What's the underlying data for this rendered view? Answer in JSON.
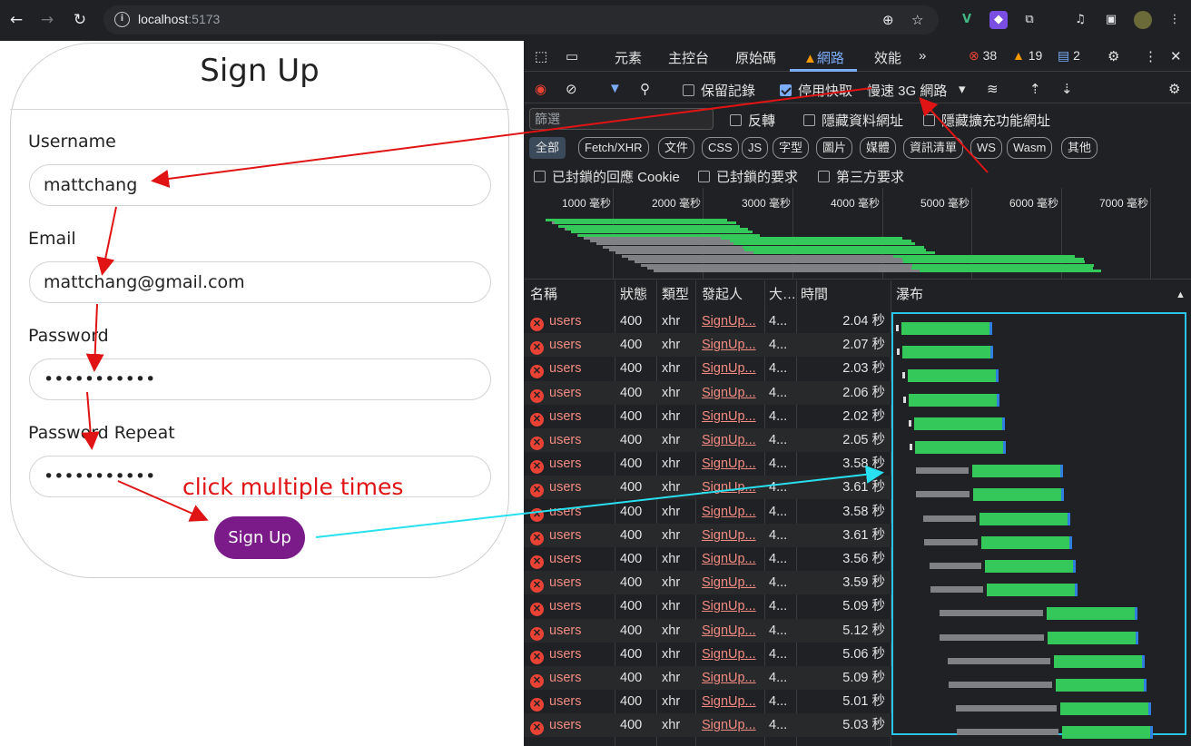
{
  "browser": {
    "url_host": "localhost",
    "url_port": ":5173",
    "nav": [
      "←",
      "→",
      "↻"
    ]
  },
  "form": {
    "title": "Sign Up",
    "fields": [
      {
        "label": "Username",
        "value": "mattchang"
      },
      {
        "label": "Email",
        "value": "mattchang@gmail.com"
      },
      {
        "label": "Password",
        "value": "•••••••••••"
      },
      {
        "label": "Password Repeat",
        "value": "•••••••••••"
      }
    ],
    "submit_label": "Sign Up",
    "annotation": "click multiple times"
  },
  "devtools": {
    "tabs": [
      "元素",
      "主控台",
      "原始碼",
      "網路",
      "效能"
    ],
    "active_tab": "網路",
    "counts": {
      "errors": "38",
      "warnings": "19",
      "messages": "2"
    },
    "toolbar": {
      "preserve_log": "保留記錄",
      "disable_cache": "停用快取",
      "throttle": "慢速 3G 網路"
    },
    "filter_placeholder": "篩選",
    "filter_options": [
      "反轉",
      "隱藏資料網址",
      "隱藏擴充功能網址"
    ],
    "type_chips": [
      "全部",
      "Fetch/XHR",
      "文件",
      "CSS",
      "JS",
      "字型",
      "圖片",
      "媒體",
      "資訊清單",
      "WS",
      "Wasm",
      "其他"
    ],
    "extra_filters": [
      "已封鎖的回應 Cookie",
      "已封鎖的要求",
      "第三方要求"
    ],
    "overview_ticks": [
      "1000 毫秒",
      "2000 毫秒",
      "3000 毫秒",
      "4000 毫秒",
      "5000 毫秒",
      "6000 毫秒",
      "7000 毫秒"
    ],
    "columns": [
      "名稱",
      "狀態",
      "類型",
      "發起人",
      "大…",
      "時間",
      "瀑布"
    ],
    "rows": [
      {
        "name": "users",
        "status": "400",
        "type": "xhr",
        "initiator": "SignUp...",
        "size": "4...",
        "time": "2.04 秒"
      },
      {
        "name": "users",
        "status": "400",
        "type": "xhr",
        "initiator": "SignUp...",
        "size": "4...",
        "time": "2.07 秒"
      },
      {
        "name": "users",
        "status": "400",
        "type": "xhr",
        "initiator": "SignUp...",
        "size": "4...",
        "time": "2.03 秒"
      },
      {
        "name": "users",
        "status": "400",
        "type": "xhr",
        "initiator": "SignUp...",
        "size": "4...",
        "time": "2.06 秒"
      },
      {
        "name": "users",
        "status": "400",
        "type": "xhr",
        "initiator": "SignUp...",
        "size": "4...",
        "time": "2.02 秒"
      },
      {
        "name": "users",
        "status": "400",
        "type": "xhr",
        "initiator": "SignUp...",
        "size": "4...",
        "time": "2.05 秒"
      },
      {
        "name": "users",
        "status": "400",
        "type": "xhr",
        "initiator": "SignUp...",
        "size": "4...",
        "time": "3.58 秒"
      },
      {
        "name": "users",
        "status": "400",
        "type": "xhr",
        "initiator": "SignUp...",
        "size": "4...",
        "time": "3.61 秒"
      },
      {
        "name": "users",
        "status": "400",
        "type": "xhr",
        "initiator": "SignUp...",
        "size": "4...",
        "time": "3.58 秒"
      },
      {
        "name": "users",
        "status": "400",
        "type": "xhr",
        "initiator": "SignUp...",
        "size": "4...",
        "time": "3.61 秒"
      },
      {
        "name": "users",
        "status": "400",
        "type": "xhr",
        "initiator": "SignUp...",
        "size": "4...",
        "time": "3.56 秒"
      },
      {
        "name": "users",
        "status": "400",
        "type": "xhr",
        "initiator": "SignUp...",
        "size": "4...",
        "time": "3.59 秒"
      },
      {
        "name": "users",
        "status": "400",
        "type": "xhr",
        "initiator": "SignUp...",
        "size": "4...",
        "time": "5.09 秒"
      },
      {
        "name": "users",
        "status": "400",
        "type": "xhr",
        "initiator": "SignUp...",
        "size": "4...",
        "time": "5.12 秒"
      },
      {
        "name": "users",
        "status": "400",
        "type": "xhr",
        "initiator": "SignUp...",
        "size": "4...",
        "time": "5.06 秒"
      },
      {
        "name": "users",
        "status": "400",
        "type": "xhr",
        "initiator": "SignUp...",
        "size": "4...",
        "time": "5.09 秒"
      },
      {
        "name": "users",
        "status": "400",
        "type": "xhr",
        "initiator": "SignUp...",
        "size": "4...",
        "time": "5.01 秒"
      },
      {
        "name": "users",
        "status": "400",
        "type": "xhr",
        "initiator": "SignUp...",
        "size": "4...",
        "time": "5.03 秒"
      }
    ],
    "colors": {
      "waiting": "#7f8185",
      "download": "#34c759",
      "highlight": "#28c5e8"
    }
  }
}
